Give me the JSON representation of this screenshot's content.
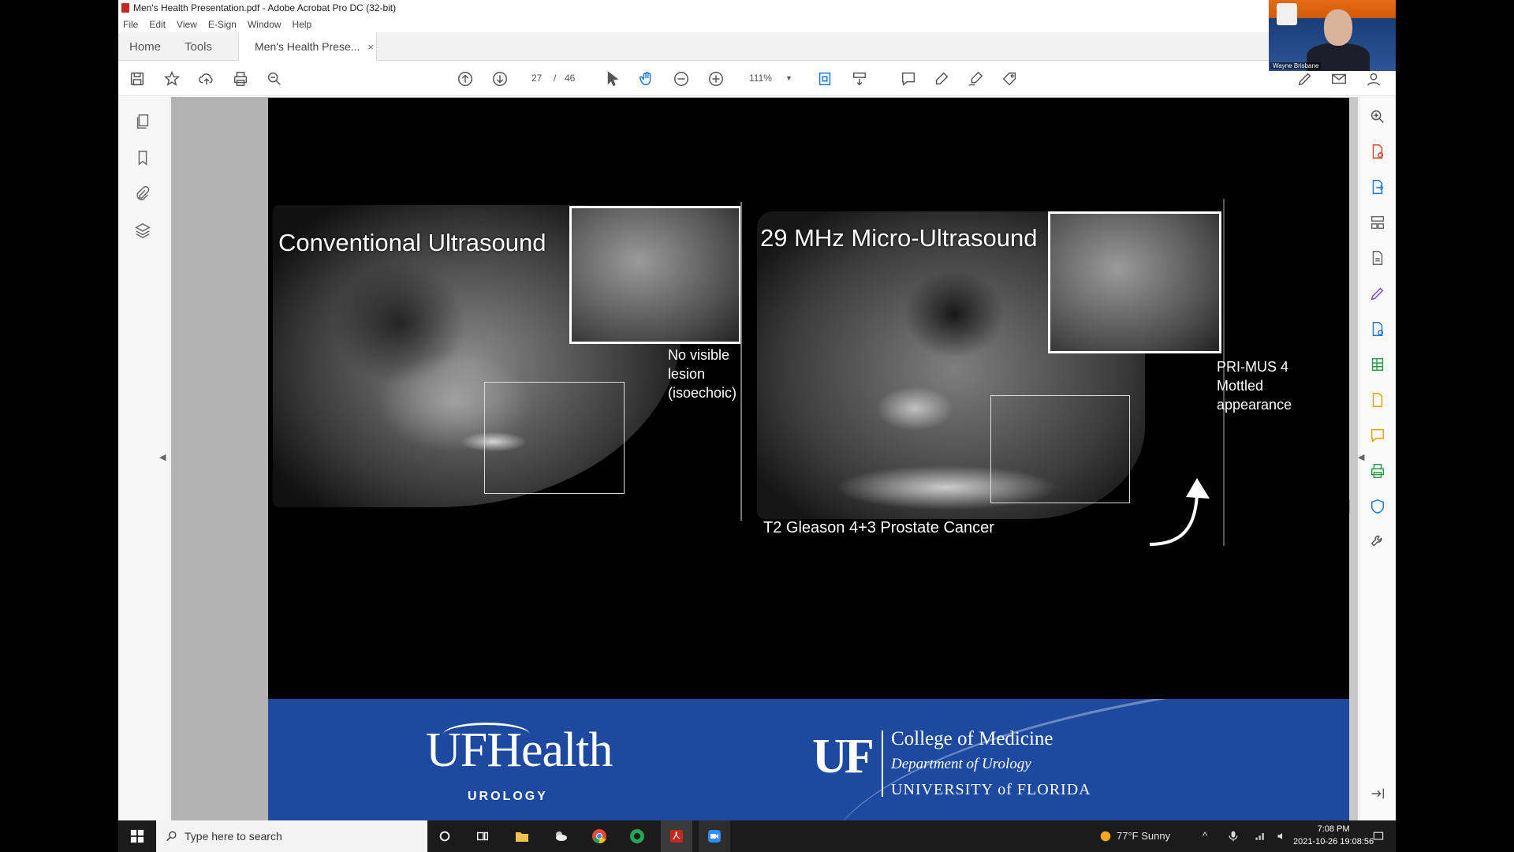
{
  "window": {
    "title": "Men's Health Presentation.pdf - Adobe Acrobat Pro DC (32-bit)"
  },
  "menu": [
    "File",
    "Edit",
    "View",
    "E-Sign",
    "Window",
    "Help"
  ],
  "tabs": {
    "home": "Home",
    "tools": "Tools",
    "document": "Men's Health Prese...",
    "close": "×"
  },
  "toolbar": {
    "page_current": "27",
    "page_sep": "/",
    "page_total": "46",
    "zoom": "111%"
  },
  "slide": {
    "left_title": "Conventional Ultrasound",
    "left_note": [
      "No visible",
      "lesion",
      "(isoechoic)"
    ],
    "right_title": "29 MHz Micro-Ultrasound",
    "right_note": [
      "PRI-MUS 4",
      "Mottled",
      "appearance"
    ],
    "caption": "T2 Gleason 4+3 Prostate Cancer",
    "banner": {
      "ufhealth": "UFHealth",
      "urology": "UROLOGY",
      "uf": "UF",
      "college": "College of Medicine",
      "department": "Department of Urology",
      "university": "UNIVERSITY of FLORIDA"
    }
  },
  "webcam": {
    "name": "Wayne Brisbane"
  },
  "taskbar": {
    "search_placeholder": "Type here to search",
    "weather": "77°F  Sunny",
    "time": "7:08 PM",
    "date": "2021-10-26 19:08:56"
  },
  "colors": {
    "acrobat_red": "#c4271c",
    "uf_blue": "#1d4aa0",
    "accent": "#1473e6"
  }
}
